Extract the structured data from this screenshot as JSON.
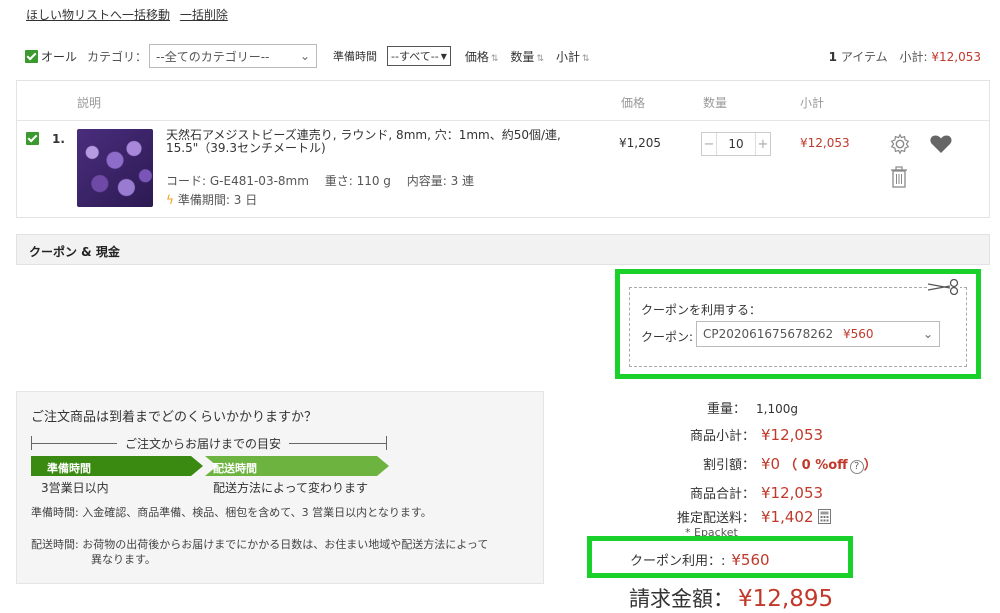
{
  "top_links": {
    "move_to_wishlist": "ほしい物リストへ一括移動",
    "delete_all": "一括削除"
  },
  "filter_bar": {
    "all_label": "オール",
    "category_label": "カテゴリ：",
    "category_value": "--全てのカテゴリー--",
    "prep_time_label": "準備時間",
    "prep_time_value": "--すべて--",
    "sort_price": "価格",
    "sort_qty": "数量",
    "sort_subtotal": "小計",
    "item_count": "1",
    "item_unit": "アイテム",
    "subtotal_label": "小計:",
    "subtotal_value": "¥12,053"
  },
  "table": {
    "headers": {
      "description": "説明",
      "price": "価格",
      "qty": "数量",
      "subtotal": "小計"
    },
    "item": {
      "index": "1.",
      "title": "天然石アメジストビーズ連売り, ラウンド, 8mm, 穴：1mm、約50個/連, 15.5\"（39.3センチメートル)",
      "code_line": "コード: G-E481-03-8mm　 重さ: 110 g　 内容量: 3 連",
      "prep_line": "準備期間: 3 日",
      "price": "¥1,205",
      "qty": "10",
      "minus": "−",
      "plus": "+",
      "subtotal": "¥12,053"
    }
  },
  "coupon_section": {
    "title": "クーポン & 現金",
    "use_coupon_label": "クーポンを利用する：",
    "coupon_label": "クーポン:",
    "coupon_code": "CP202061675678262",
    "coupon_amount": "¥560"
  },
  "delivery_info": {
    "question": "ご注文商品は到着までどのくらいかかりますか？",
    "timeline_caption": "ご注文からお届けまでの目安",
    "prep_stage": "準備時間",
    "ship_stage": "配送時間",
    "prep_desc": "3営業日以内",
    "ship_desc": "配送方法によって変わります",
    "note1_label": "準備時間:",
    "note1_text": "入金確認、商品準備、検品、梱包を含めて、3 営業日以内となります。",
    "note2_label": "配送時間:",
    "note2_text_a": "お荷物の出荷後からお届けまでにかかる日数は、お住まい地域や配送方法によって",
    "note2_text_b": "異なります。"
  },
  "summary": {
    "weight_label": "重量：",
    "weight_value": "1,100g",
    "subtotal_label": "商品小計：",
    "subtotal_value": "¥12,053",
    "discount_label": "割引額：",
    "discount_value": "¥0",
    "discount_note": "（ 0 %off",
    "discount_note_end": "）",
    "total_label": "商品合計：",
    "total_value": "¥12,053",
    "shipping_label": "推定配送料：",
    "shipping_value": "¥1,402",
    "shipping_method": "* Epacket",
    "coupon_used_label": "クーポン利用：:",
    "coupon_used_value": "¥560",
    "grand_label": "請求金額：",
    "grand_value": "¥12,895"
  },
  "colors": {
    "accent_red": "#c0392b",
    "check_green": "#3a9a2e",
    "highlight_green": "#19d12a",
    "stage_dark": "#3a8a12",
    "stage_light": "#6db33f"
  }
}
